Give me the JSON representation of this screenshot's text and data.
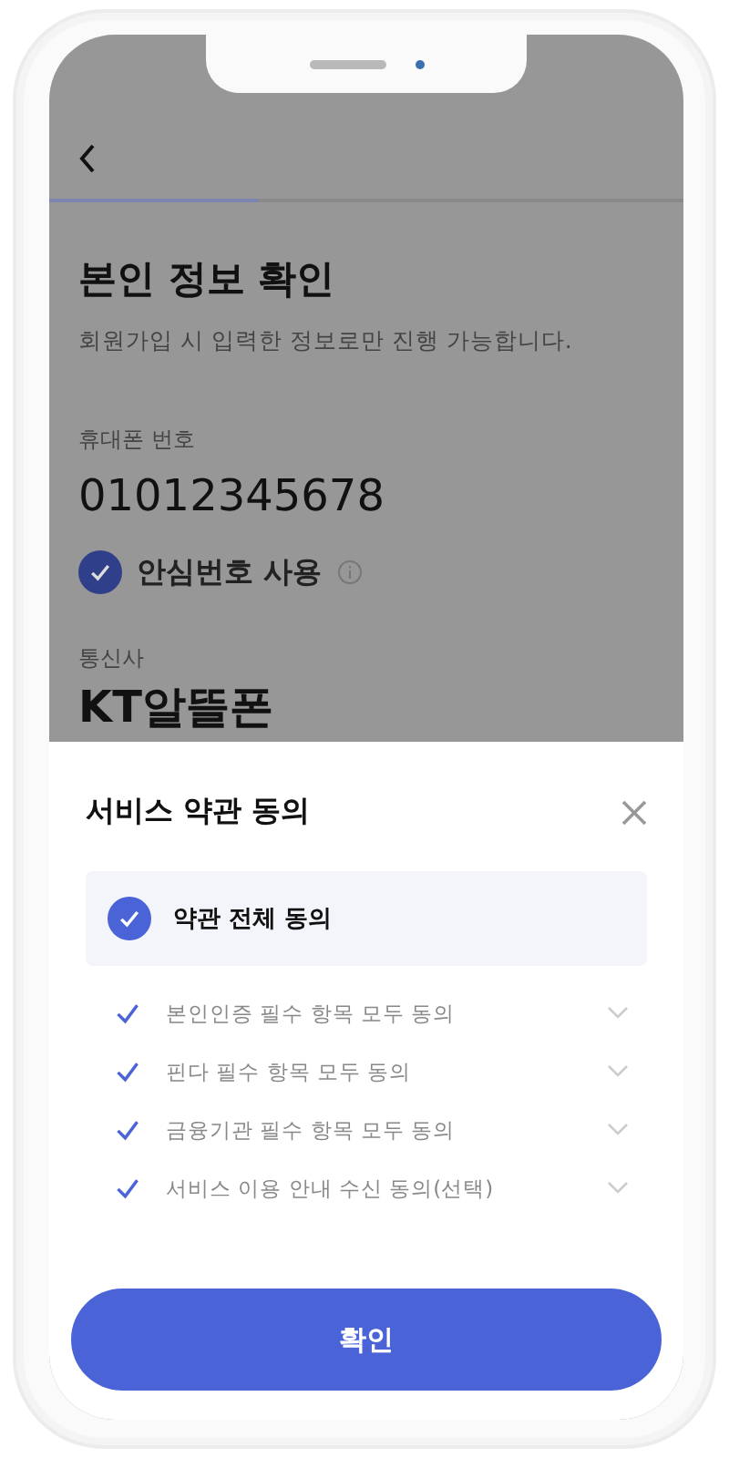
{
  "header": {
    "progress": {
      "level": 0.33
    }
  },
  "page": {
    "title": "본인 정보 확인",
    "subtitle": "회원가입 시 입력한 정보로만 진행 가능합니다.",
    "phone_label": "휴대폰 번호",
    "phone_value": "01012345678",
    "safe_number": {
      "label": "안심번호 사용",
      "checked": true
    },
    "carrier_label": "통신사",
    "carrier_value": "KT알뜰폰"
  },
  "sheet": {
    "title": "서비스 약관 동의",
    "agree_all": {
      "label": "약관 전체 동의",
      "checked": true
    },
    "items": [
      {
        "label": "본인인증 필수 항목 모두 동의",
        "checked": true,
        "expanded": false
      },
      {
        "label": "핀다 필수 항목 모두 동의",
        "checked": true,
        "expanded": false
      },
      {
        "label": "금융기관 필수 항목 모두 동의",
        "checked": true,
        "expanded": false
      },
      {
        "label": "서비스 이용 안내 수신 동의(선택)",
        "checked": true,
        "expanded": false
      }
    ],
    "confirm_button": "확인"
  }
}
